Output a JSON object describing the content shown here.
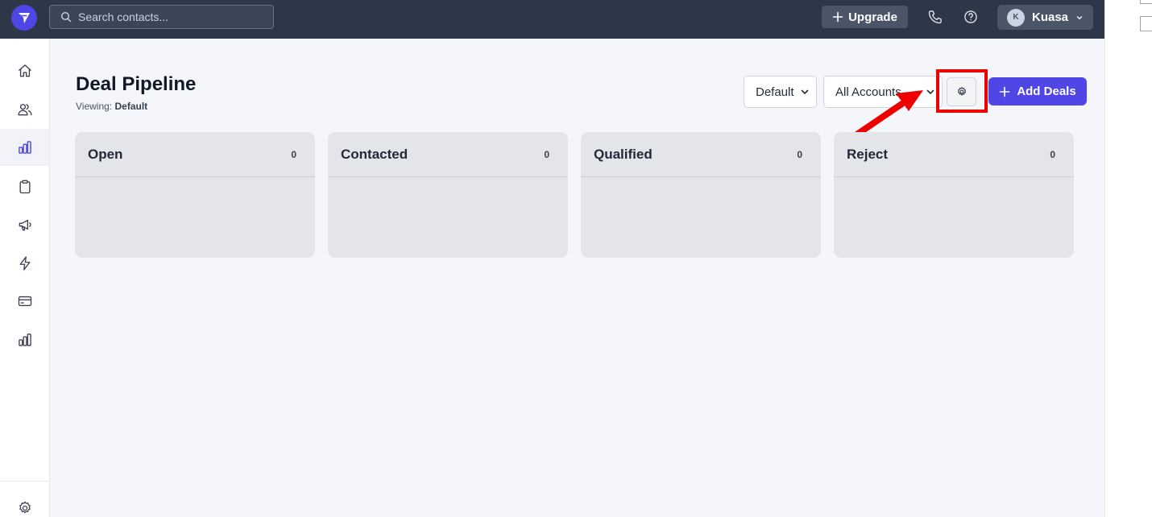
{
  "search": {
    "placeholder": "Search contacts..."
  },
  "topbar": {
    "upgrade_label": "Upgrade",
    "user": {
      "initial": "K",
      "name": "Kuasa"
    }
  },
  "sidebar": {
    "items": [
      {
        "name": "home",
        "icon": "home-icon"
      },
      {
        "name": "contacts",
        "icon": "users-icon"
      },
      {
        "name": "deals",
        "icon": "bar-chart-icon",
        "active": true
      },
      {
        "name": "tasks",
        "icon": "clipboard-icon"
      },
      {
        "name": "campaigns",
        "icon": "megaphone-icon"
      },
      {
        "name": "automations",
        "icon": "lightning-icon"
      },
      {
        "name": "billing",
        "icon": "credit-card-icon"
      },
      {
        "name": "reports",
        "icon": "bar-chart-icon"
      }
    ],
    "bottom_icon": "gear-icon"
  },
  "page": {
    "title": "Deal Pipeline",
    "viewing_label": "Viewing:",
    "viewing_value": "Default"
  },
  "controls": {
    "pipeline_select": "Default",
    "accounts_select": "All Accounts",
    "settings_icon": "gear-icon",
    "add_deals_label": "Add Deals"
  },
  "stages": [
    {
      "name": "Open",
      "count": "0"
    },
    {
      "name": "Contacted",
      "count": "0"
    },
    {
      "name": "Qualified",
      "count": "0"
    },
    {
      "name": "Reject",
      "count": "0"
    }
  ],
  "colors": {
    "topbar": "#2d3748",
    "accent": "#4f46e5",
    "highlight": "#ee0000",
    "stage_bg": "#e4e5e9"
  }
}
